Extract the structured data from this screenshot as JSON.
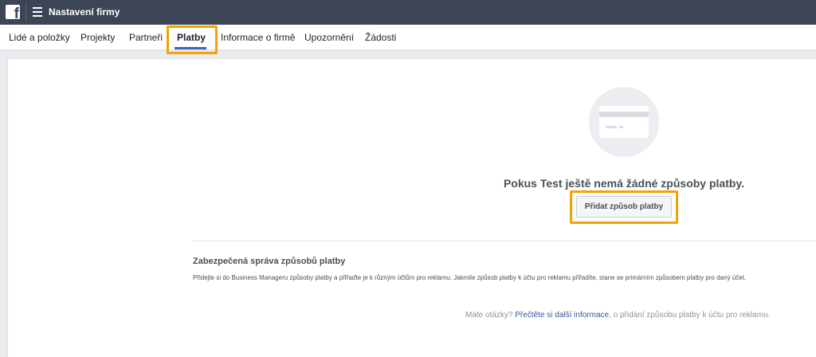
{
  "header": {
    "logo_letter": "f",
    "title": "Nastavení firmy"
  },
  "tabs": [
    {
      "label": "Lidé a položky"
    },
    {
      "label": "Projekty"
    },
    {
      "label": "Partneři"
    },
    {
      "label": "Platby"
    },
    {
      "label": "Informace o firmě"
    },
    {
      "label": "Upozornění"
    },
    {
      "label": "Žádosti"
    }
  ],
  "active_tab": "Platby",
  "empty_state": {
    "message": "Pokus Test ještě nemá žádné způsoby platby.",
    "add_button_label": "Přidat způsob platby"
  },
  "info_section": {
    "title": "Zabezpečená správa způsobů platby",
    "description": "Přidejte si do Business Manageru způsoby platby a přiřaďte je k různým účtům pro reklamu. Jakmile způsob platby k účtu pro reklamu přiřadíte, stane se primárním způsobem platby pro daný účet."
  },
  "help": {
    "prefix": "Máte otázky?",
    "link_text": "Přečtěte si další informace",
    "suffix": ", o přidání způsobu platby k účtu pro reklamu."
  },
  "colors": {
    "topbar": "#3b4556",
    "accent": "#4267b2",
    "highlight": "#f5a200",
    "link": "#365899"
  }
}
